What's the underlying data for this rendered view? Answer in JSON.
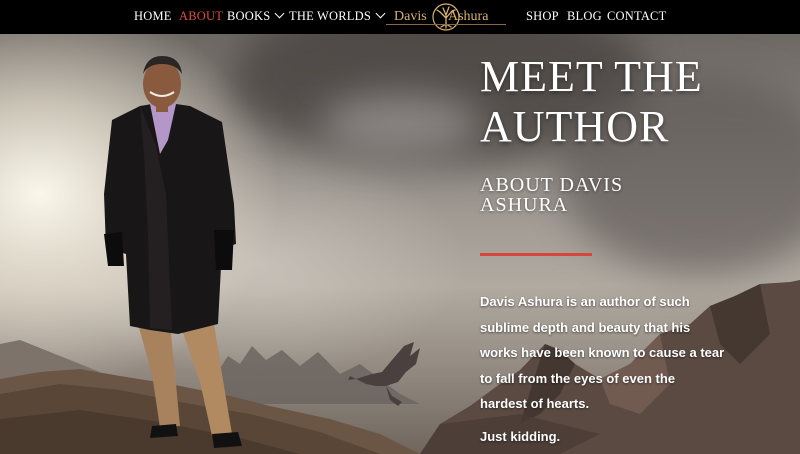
{
  "nav": {
    "items": [
      {
        "label": "HOME"
      },
      {
        "label": "ABOUT"
      },
      {
        "label": "BOOKS"
      },
      {
        "label": "THE WORLDS"
      },
      {
        "label": "SHOP"
      },
      {
        "label": "BLOG"
      },
      {
        "label": "CONTACT"
      }
    ],
    "active_color": "#e0503a",
    "logo": {
      "word1": "Davis",
      "word2": "Ashura"
    }
  },
  "hero": {
    "title_line1": "MEET THE",
    "title_line2": "AUTHOR",
    "subtitle_line1": "ABOUT DAVIS",
    "subtitle_line2": "ASHURA",
    "accent_color": "#d8453a",
    "bio_lines": [
      "Davis Ashura is an author of such",
      "sublime depth and beauty that his",
      "works have been known to cause a tear",
      "to fall from the eyes of even the",
      "hardest of hearts."
    ],
    "bio_2": "Just kidding."
  }
}
